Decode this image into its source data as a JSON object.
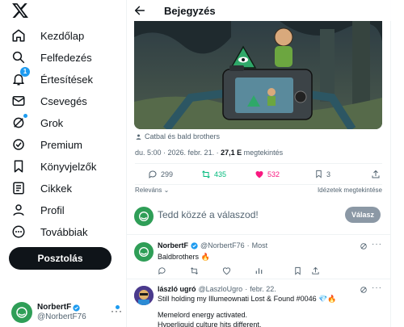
{
  "nav": {
    "items": [
      {
        "label": "Kezdőlap",
        "icon": "home-icon"
      },
      {
        "label": "Felfedezés",
        "icon": "search-icon"
      },
      {
        "label": "Értesítések",
        "icon": "bell-icon",
        "badge": "1"
      },
      {
        "label": "Csevegés",
        "icon": "mail-icon"
      },
      {
        "label": "Grok",
        "icon": "grok-icon"
      },
      {
        "label": "Premium",
        "icon": "verified-icon"
      },
      {
        "label": "Könyvjelzők",
        "icon": "bookmark-icon"
      },
      {
        "label": "Cikkek",
        "icon": "article-icon"
      },
      {
        "label": "Profil",
        "icon": "profile-icon"
      },
      {
        "label": "Továbbiak",
        "icon": "more-circle-icon"
      }
    ],
    "post_button": "Posztolás",
    "account": {
      "name": "NorbertF",
      "handle": "@NorbertF76"
    }
  },
  "header": {
    "title": "Bejegyzés"
  },
  "post": {
    "caption": "Catbal és bald brothers",
    "meta_time": "du. 5:00 · 2026. febr. 21. · ",
    "meta_views": "27,1 E",
    "meta_views_label": " megtekintés",
    "replies": "299",
    "reposts": "435",
    "likes": "532",
    "bookmarks": "3",
    "sort_label": "Releváns",
    "quotes_label": "Idézetek megtekintése"
  },
  "compose": {
    "placeholder": "Tedd közzé a válaszod!",
    "reply_button": "Válasz"
  },
  "replies": [
    {
      "name": "NorbertF",
      "handle": "@NorbertF76",
      "time": "Most",
      "text": "Baldbrothers 🔥"
    },
    {
      "name": "lászló ugró",
      "handle": "@LaszloUgro",
      "time": "febr. 22.",
      "line1": "Still holding my Illumeownati Lost & Found #0046 💎🔥",
      "line2": "Memelord energy activated.",
      "line3": "Hyperliquid culture hits different."
    }
  ],
  "colors": {
    "accent": "#1d9bf0",
    "green": "#00ba7c",
    "pink": "#f91880",
    "dark": "#0f1419",
    "muted": "#536471"
  }
}
